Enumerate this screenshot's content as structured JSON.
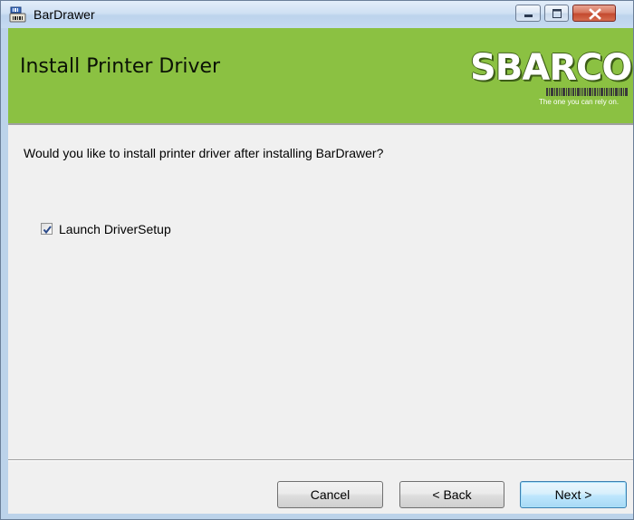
{
  "window": {
    "title": "BarDrawer",
    "icon": "bardrawer-app-icon",
    "controls": [
      "minimize-icon",
      "maximize-icon",
      "close-icon"
    ]
  },
  "banner": {
    "title": "Install Printer Driver",
    "logo_text": "SBARCO",
    "logo_tagline": "The one you can rely on.",
    "background_color": "#8bc142"
  },
  "content": {
    "question": "Would you like to install printer driver after installing BarDrawer?",
    "launch_checkbox": {
      "label": "Launch DriverSetup",
      "checked": true
    }
  },
  "buttons": {
    "cancel": "Cancel",
    "back": "< Back",
    "next": "Next >"
  }
}
